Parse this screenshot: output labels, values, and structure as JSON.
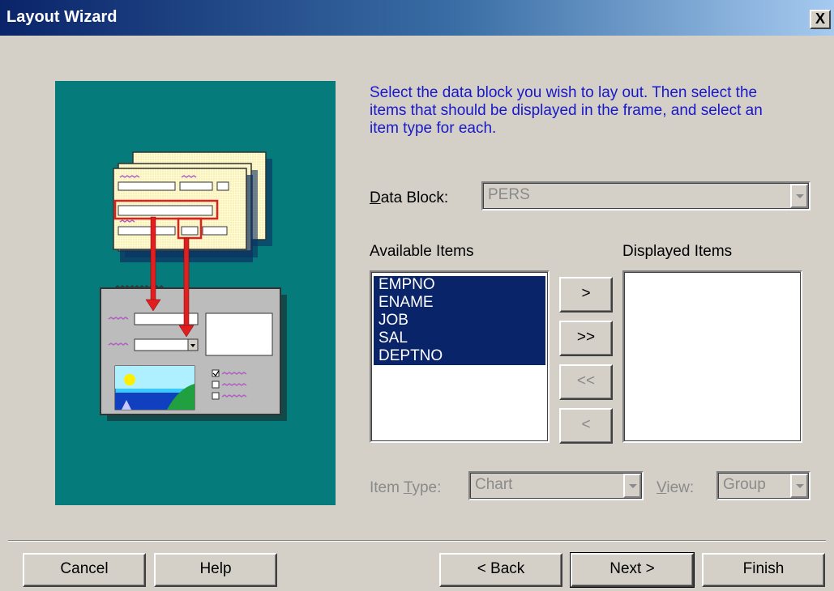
{
  "window": {
    "title": "Layout Wizard",
    "close_symbol": "X"
  },
  "instructions": "Select the data block you wish to lay out. Then select the items that should be displayed in the frame, and select an item type for each.",
  "data_block": {
    "label_prefix": "",
    "label_underlined": "D",
    "label_rest": "ata Block:",
    "value": "PERS"
  },
  "available_items": {
    "label": "Available Items",
    "items": [
      "EMPNO",
      "ENAME",
      "JOB",
      "SAL",
      "DEPTNO"
    ]
  },
  "displayed_items": {
    "label": "Displayed Items",
    "items": []
  },
  "transfer_buttons": {
    "move_one": ">",
    "move_all": ">>",
    "remove_all": "<<",
    "remove_one": "<"
  },
  "item_type": {
    "label_prefix": "Item ",
    "label_underlined": "T",
    "label_rest": "ype:",
    "value": "Chart"
  },
  "view": {
    "label_underlined": "V",
    "label_rest": "iew:",
    "value": "Group"
  },
  "footer": {
    "cancel": "Cancel",
    "help": "Help",
    "back": "< Back",
    "next": "Next >",
    "finish": "Finish"
  },
  "colors": {
    "title_start": "#0a246a",
    "title_end": "#a6caf0",
    "instruction_text": "#1818c8",
    "selection": "#0a246a",
    "illustration_bg": "#067b7b",
    "dialog_bg": "#d4d0c8"
  }
}
